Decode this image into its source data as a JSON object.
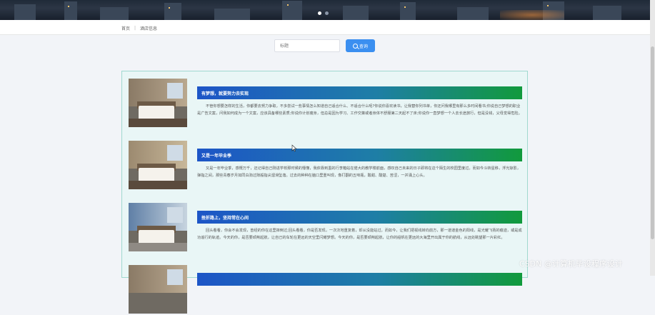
{
  "breadcrumb": {
    "home": "首页",
    "separator": "|",
    "current": "酒店信息"
  },
  "search": {
    "placeholder": "标题",
    "button_label": "查询",
    "button_icon": "search-icon"
  },
  "banner": {
    "dots": 2,
    "active_dot": 0
  },
  "articles": [
    {
      "title": "有梦想，就要努力去实现",
      "summary": "不管你想要怎样的生活，你都要去努力争取，不多尝试一些事情怎么知道自己适合什么、不适合什么呢?你说你喜欢读书，让我替你列书单，你还问我哪里有那么多时间看书;你说自己梦想的职业是广告文案，问我如何成为一个文案，应该具备哪些素质;你说你计划瘦身，但总是因为学习、工作交策或者身体不舒服第二天起不了床;你说你一直梦想一个人去长途旅行，但是没钱，父母觉得危险。"
    },
    {
      "title": "又是一年毕业季",
      "summary": "又是一年毕业季，感慨万千，还记得自己刚进学校那时候的懵懂，我依靠到墨的行李箱站在偌大的教学楼前面，感叹自己未来的日子即将在这个陌生的校园里度过。而如今斗转星移，浮光掠影，弹指之间，那些青春岁月如同白驹过隙般指尖溜滑坠落。过去的种种在脑口里重叫现，像打翻的五味瓶，酸甜、酸楚、苦涩，一并涌上心头。"
    },
    {
      "title": "挫折路上，坚持常在心间",
      "summary": "回头看看，你会不会发现，曾经的你在这里摔倒过;回头看看，你是否发现，一次次地重复着，却从没能站过。而如今，让我们把视线转向前方，那一道道金色的阳线，是光耀飞扬的痕迹，或是成功追行的轨迹。今天的你，是否要顽荆起航，让自己的车轮在更远的天空里闪耀梦想。今天的你，是否要顽荆起航，让你的船帆在更远的大海里开出属于你的航线，从远处眺望那一片彩红。"
    }
  ],
  "watermark": "CSDN @计算机毕设程序设计"
}
